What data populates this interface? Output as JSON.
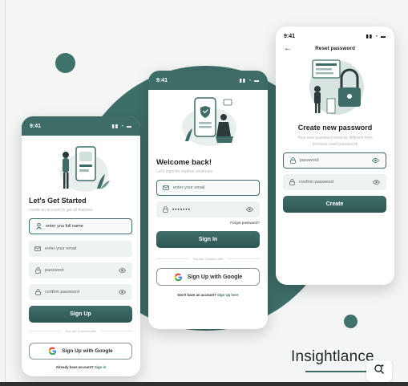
{
  "colors": {
    "accent": "#3e6c66",
    "background": "#f4f5f5",
    "text": "#1b1f1f",
    "muted": "#b3b8b8"
  },
  "brand": {
    "name": "Insightlance"
  },
  "signup": {
    "time": "9:41",
    "title": "Let's Get Started",
    "subtitle": "create an  account to get all features",
    "name_value": "enter you full name",
    "email_placeholder": "enter your email",
    "password_placeholder": "password",
    "confirm_placeholder": "confirm password",
    "button": "Sign Up",
    "divider": "You can Connect with",
    "google_button": "Sign Up with Google",
    "footer_text": "Already have account?",
    "footer_link": "Sign in"
  },
  "login": {
    "time": "9:41",
    "title": "Welcome back!",
    "subtitle": "Let's login for explore continues",
    "email_placeholder": "enter your email",
    "password_value": "•••••••",
    "forgot": "Forgot password?",
    "button": "Sign In",
    "divider": "You can Connect with",
    "google_button": "Sign Up with Google",
    "footer_text": "Don't have an account?",
    "footer_link": "Sign Up here"
  },
  "reset": {
    "time": "9:41",
    "header": "Reset password",
    "title": "Create new password",
    "subtitle_line1": "Your new password must be different from",
    "subtitle_line2": "previous used passwords",
    "password_placeholder": "password",
    "confirm_placeholder": "confirm password",
    "button": "Create"
  }
}
